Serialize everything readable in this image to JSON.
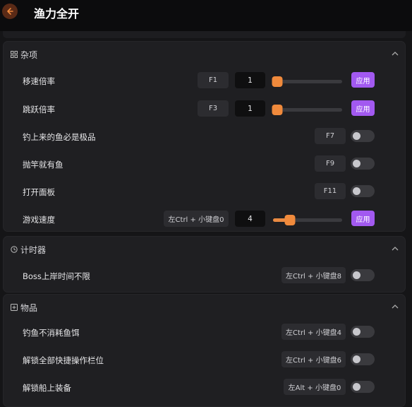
{
  "header": {
    "title": "渔力全开",
    "back_icon": "arrow-left-icon",
    "accent": "#f08a3c"
  },
  "colors": {
    "apply_button": "#a259f0",
    "slider": "#f08a3c"
  },
  "sections": [
    {
      "title": "杂项",
      "icon": "grid-icon",
      "rows": [
        {
          "label": "移速倍率",
          "hotkey": "F1",
          "value": "1",
          "slider_fraction": 0.0,
          "apply": "应用"
        },
        {
          "label": "跳跃倍率",
          "hotkey": "F3",
          "value": "1",
          "slider_fraction": 0.0,
          "apply": "应用"
        },
        {
          "label": "钓上来的鱼必是极品",
          "hotkey": "F7",
          "toggle": false
        },
        {
          "label": "抛竿就有鱼",
          "hotkey": "F9",
          "toggle": false
        },
        {
          "label": "打开面板",
          "hotkey": "F11",
          "toggle": false
        },
        {
          "label": "游戏速度",
          "hotkey": "左Ctrl + 小键盘0",
          "value": "4",
          "slider_fraction": 0.2,
          "apply": "应用"
        }
      ]
    },
    {
      "title": "计时器",
      "icon": "clock-icon",
      "rows": [
        {
          "label": "Boss上岸时间不限",
          "hotkey": "左Ctrl + 小键盘8",
          "toggle": false
        }
      ]
    },
    {
      "title": "物品",
      "icon": "plus-square-icon",
      "rows": [
        {
          "label": "钓鱼不消耗鱼饵",
          "hotkey": "左Ctrl + 小键盘4",
          "toggle": false
        },
        {
          "label": "解锁全部快捷操作栏位",
          "hotkey": "左Ctrl + 小键盘6",
          "toggle": false
        },
        {
          "label": "解锁船上装备",
          "hotkey": "左Alt + 小键盘0",
          "toggle": false
        }
      ]
    }
  ]
}
